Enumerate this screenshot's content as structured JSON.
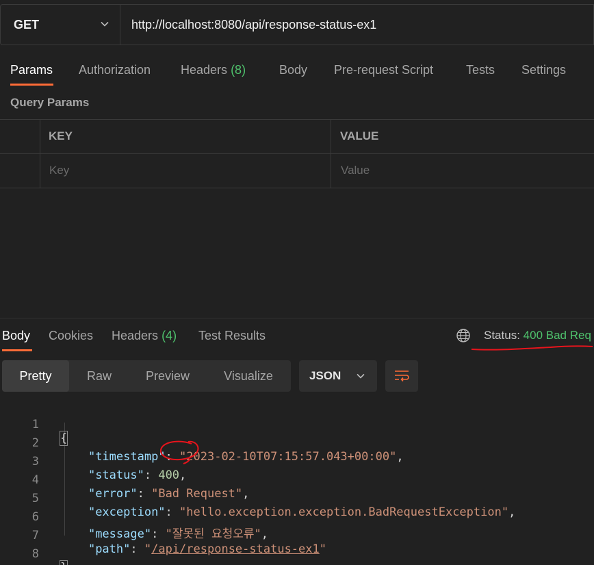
{
  "request": {
    "method": "GET",
    "url": "http://localhost:8080/api/response-status-ex1"
  },
  "req_tabs": {
    "params": "Params",
    "authorization": "Authorization",
    "headers": "Headers",
    "headers_count": "(8)",
    "body": "Body",
    "pre_request": "Pre-request Script",
    "tests": "Tests",
    "settings": "Settings"
  },
  "query_params": {
    "title": "Query Params",
    "key_header": "KEY",
    "value_header": "VALUE",
    "key_placeholder": "Key",
    "value_placeholder": "Value"
  },
  "resp_tabs": {
    "body": "Body",
    "cookies": "Cookies",
    "headers": "Headers",
    "headers_count": "(4)",
    "test_results": "Test Results"
  },
  "status": {
    "label": "Status:",
    "value": "400 Bad Req"
  },
  "view": {
    "pretty": "Pretty",
    "raw": "Raw",
    "preview": "Preview",
    "visualize": "Visualize",
    "format": "JSON"
  },
  "code": {
    "line_numbers": [
      "1",
      "2",
      "3",
      "4",
      "5",
      "6",
      "7",
      "8"
    ],
    "open_brace": "{",
    "close_brace": "}",
    "timestamp_key": "\"timestamp\"",
    "timestamp_val": "\"2023-02-10T07:15:57.043+00:00\"",
    "status_key": "\"status\"",
    "status_val": "400",
    "error_key": "\"error\"",
    "error_val": "\"Bad Request\"",
    "exception_key": "\"exception\"",
    "exception_val": "\"hello.exception.exception.BadRequestException\"",
    "message_key": "\"message\"",
    "message_val": "\"잘못된 요청오류\"",
    "path_key": "\"path\"",
    "path_quote": "\"",
    "path_link": "/api/response-status-ex1"
  },
  "colors": {
    "accent": "#ff6c37",
    "status_ok": "#4fc36d",
    "annotation": "#e8141c"
  }
}
